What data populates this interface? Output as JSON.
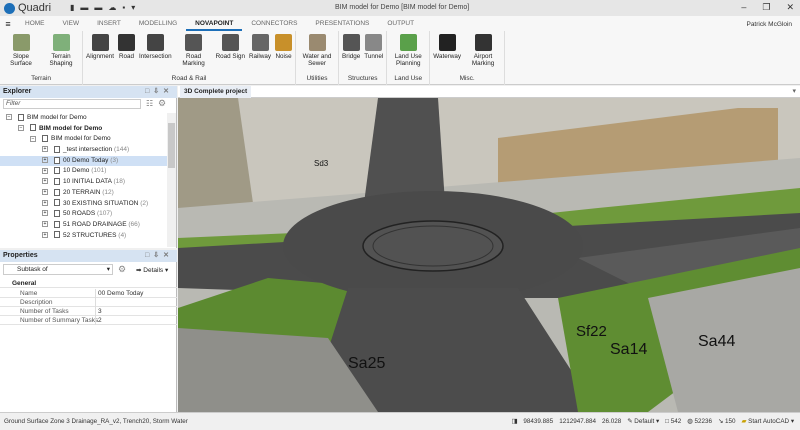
{
  "app": {
    "name": "Quadri",
    "window_title": "BIM model for Demo  [BIM model for Demo]",
    "user": "Patrick McGloin"
  },
  "tabs": [
    "HOME",
    "VIEW",
    "INSERT",
    "MODELLING",
    "NOVAPOINT",
    "CONNECTORS",
    "PRESENTATIONS",
    "OUTPUT"
  ],
  "active_tab": "NOVAPOINT",
  "ribbon": [
    {
      "group": "Terrain",
      "buttons": [
        {
          "label": "Slope Surface",
          "color": "#8a9a6a"
        },
        {
          "label": "Terrain Shaping",
          "color": "#7fb07a"
        }
      ]
    },
    {
      "group": "Road & Rail",
      "buttons": [
        {
          "label": "Alignment",
          "color": "#444"
        },
        {
          "label": "Road",
          "color": "#333"
        },
        {
          "label": "Intersection",
          "color": "#444"
        },
        {
          "label": "Road Marking",
          "color": "#555"
        },
        {
          "label": "Road Sign",
          "color": "#555"
        },
        {
          "label": "Railway",
          "color": "#666"
        },
        {
          "label": "Noise",
          "color": "#c8902a"
        }
      ]
    },
    {
      "group": "Utilities",
      "buttons": [
        {
          "label": "Water and Sewer",
          "color": "#9a8a70"
        }
      ]
    },
    {
      "group": "Structures",
      "buttons": [
        {
          "label": "Bridge",
          "color": "#555"
        },
        {
          "label": "Tunnel",
          "color": "#888"
        }
      ]
    },
    {
      "group": "Land Use",
      "buttons": [
        {
          "label": "Land Use Planning",
          "color": "#5aa04a"
        }
      ]
    },
    {
      "group": "Misc.",
      "buttons": [
        {
          "label": "Waterway",
          "color": "#222"
        },
        {
          "label": "Airport Marking",
          "color": "#333"
        }
      ]
    }
  ],
  "explorer": {
    "title": "Explorer",
    "filter_placeholder": "Filter",
    "items": [
      {
        "label": "BIM model for Demo",
        "count": "",
        "level": 0,
        "bold": false
      },
      {
        "label": "BIM model for Demo",
        "count": "",
        "level": 1,
        "bold": true
      },
      {
        "label": "BIM model for Demo",
        "count": "",
        "level": 2,
        "bold": false
      },
      {
        "label": "_test intersection",
        "count": "(144)",
        "level": 3
      },
      {
        "label": "00 Demo Today",
        "count": "(3)",
        "level": 3,
        "selected": true
      },
      {
        "label": "10 Demo",
        "count": "(101)",
        "level": 3
      },
      {
        "label": "10 INITIAL DATA",
        "count": "(18)",
        "level": 3
      },
      {
        "label": "20 TERRAIN",
        "count": "(12)",
        "level": 3
      },
      {
        "label": "30 EXISTING SITUATION",
        "count": "(2)",
        "level": 3
      },
      {
        "label": "50 ROADS",
        "count": "(107)",
        "level": 3
      },
      {
        "label": "51 ROAD DRAINAGE",
        "count": "(66)",
        "level": 3
      },
      {
        "label": "52 STRUCTURES",
        "count": "(4)",
        "level": 3
      }
    ]
  },
  "properties": {
    "title": "Properties",
    "selector": "Subtask of",
    "details": "Details",
    "section": "General",
    "rows": [
      {
        "k": "Name",
        "v": "00 Demo Today"
      },
      {
        "k": "Description",
        "v": ""
      },
      {
        "k": "Number of Tasks",
        "v": "3"
      },
      {
        "k": "Number of Summary Tasks",
        "v": "2"
      }
    ]
  },
  "viewport": {
    "tab": "3D Complete project",
    "labels": [
      "Sd3",
      "Sf22",
      "Sa14",
      "Sa44",
      "Sa25"
    ]
  },
  "status": {
    "left": "Ground Surface Zone 3 Drainage_RA_v2, Trench20, Storm Water",
    "x": "98439.885",
    "y": "1212947.884",
    "z": "26.028",
    "style": "Default",
    "n1": "542",
    "n2": "52236",
    "n3": "150",
    "autocad": "Start AutoCAD"
  }
}
